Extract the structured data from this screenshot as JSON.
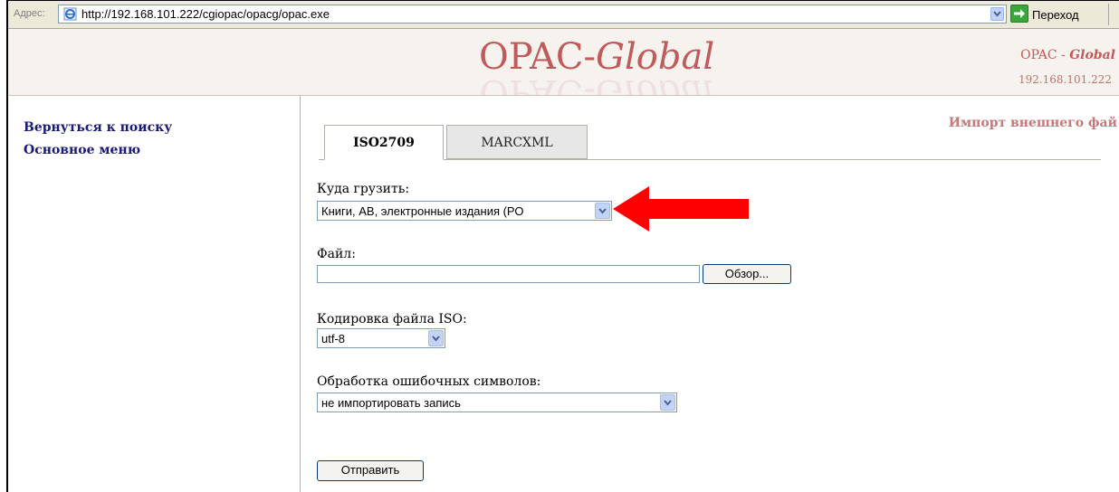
{
  "browser": {
    "address_label": "Адрес:",
    "url": "http://192.168.101.222/cgiopac/opacg/opac.exe",
    "go_label": "Переход"
  },
  "header": {
    "logo_opac": "OPAC-",
    "logo_global": "Global",
    "right_title_opac": "OPAC - ",
    "right_title_global": "Global",
    "server_ip": "192.168.101.222"
  },
  "sidebar": {
    "items": [
      {
        "label": "Вернуться к поиску"
      },
      {
        "label": "Основное меню"
      }
    ]
  },
  "main": {
    "page_title": "Импорт внешнего фай",
    "tabs": [
      {
        "label": "ISO2709",
        "active": true
      },
      {
        "label": "MARCXML",
        "active": false
      }
    ],
    "target": {
      "label": "Куда грузить:",
      "selected": "Книги, АВ, электронные издания (РО"
    },
    "file": {
      "label": "Файл:",
      "value": "",
      "browse_label": "Обзор..."
    },
    "encoding": {
      "label": "Кодировка файла ISO:",
      "selected": "utf-8"
    },
    "errors": {
      "label": "Обработка ошибочных символов:",
      "selected": "не импортировать запись"
    },
    "submit_label": "Отправить"
  },
  "colors": {
    "brand": "#c15a5a",
    "link": "#1a1a7a",
    "annotation_arrow": "#ff0000"
  }
}
